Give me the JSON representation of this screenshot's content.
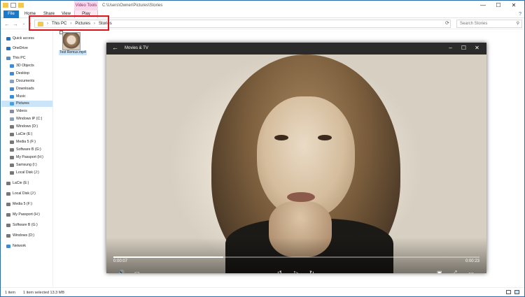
{
  "window": {
    "title_path": "C:\\Users\\Owner\\Pictures\\Stories",
    "contextual_tab": "Video Tools",
    "controls": [
      "—",
      "☐",
      "✕"
    ]
  },
  "ribbon": {
    "tabs": [
      "File",
      "Home",
      "Share",
      "View",
      "Play"
    ]
  },
  "address": {
    "crumbs": [
      "This PC",
      "Pictures",
      "Stories"
    ],
    "search_placeholder": "Search Stories"
  },
  "sidebar": {
    "items": [
      {
        "label": "Quick access",
        "icon": "star-icon",
        "color": "#1e73c8"
      },
      {
        "label": "OneDrive",
        "icon": "cloud-icon",
        "color": "#1e73c8"
      },
      {
        "label": "This PC",
        "icon": "pc-icon",
        "color": "#5a8ac0"
      },
      {
        "label": "3D Objects",
        "icon": "cube-icon",
        "color": "#3c8bd8"
      },
      {
        "label": "Desktop",
        "icon": "desktop-icon",
        "color": "#3c8bd8"
      },
      {
        "label": "Documents",
        "icon": "document-icon",
        "color": "#8aa0b8"
      },
      {
        "label": "Downloads",
        "icon": "download-icon",
        "color": "#3c8bd8"
      },
      {
        "label": "Music",
        "icon": "music-icon",
        "color": "#3c8bd8"
      },
      {
        "label": "Pictures",
        "icon": "pictures-icon",
        "color": "#4aa0d8"
      },
      {
        "label": "Videos",
        "icon": "videos-icon",
        "color": "#8a8aa8"
      },
      {
        "label": "Windows IP (C:)",
        "icon": "drive-icon",
        "color": "#8aa0b8"
      },
      {
        "label": "Windows (D:)",
        "icon": "drive-icon",
        "color": "#777777"
      },
      {
        "label": "LaCie (E:)",
        "icon": "drive-icon",
        "color": "#777777"
      },
      {
        "label": "Media 5 (F:)",
        "icon": "drive-icon",
        "color": "#777777"
      },
      {
        "label": "Software B (G:)",
        "icon": "drive-icon",
        "color": "#777777"
      },
      {
        "label": "My Passport (H:)",
        "icon": "drive-icon",
        "color": "#777777"
      },
      {
        "label": "Samsung (I:)",
        "icon": "drive-icon",
        "color": "#777777"
      },
      {
        "label": "Local Disk (J:)",
        "icon": "drive-icon",
        "color": "#777777"
      },
      {
        "label": "LaCie (E:)",
        "icon": "drive-icon",
        "color": "#777777"
      },
      {
        "label": "Local Disk (J:)",
        "icon": "drive-icon",
        "color": "#777777"
      },
      {
        "label": "Media 5 (F:)",
        "icon": "drive-icon",
        "color": "#777777"
      },
      {
        "label": "My Passport (H:)",
        "icon": "drive-icon",
        "color": "#777777"
      },
      {
        "label": "Software B (G:)",
        "icon": "drive-icon",
        "color": "#777777"
      },
      {
        "label": "Windows (D:)",
        "icon": "drive-icon",
        "color": "#777777"
      },
      {
        "label": "Network",
        "icon": "network-icon",
        "color": "#3c8bd8"
      }
    ]
  },
  "content": {
    "file_name": "Test Remux.mp4"
  },
  "player": {
    "title": "Movies & TV",
    "elapsed": "0:00:07",
    "duration": "0:00:23",
    "progress_fraction": 0.3
  },
  "status": {
    "item_count": "1 item",
    "selection": "1 item selected  13.3 MB"
  }
}
